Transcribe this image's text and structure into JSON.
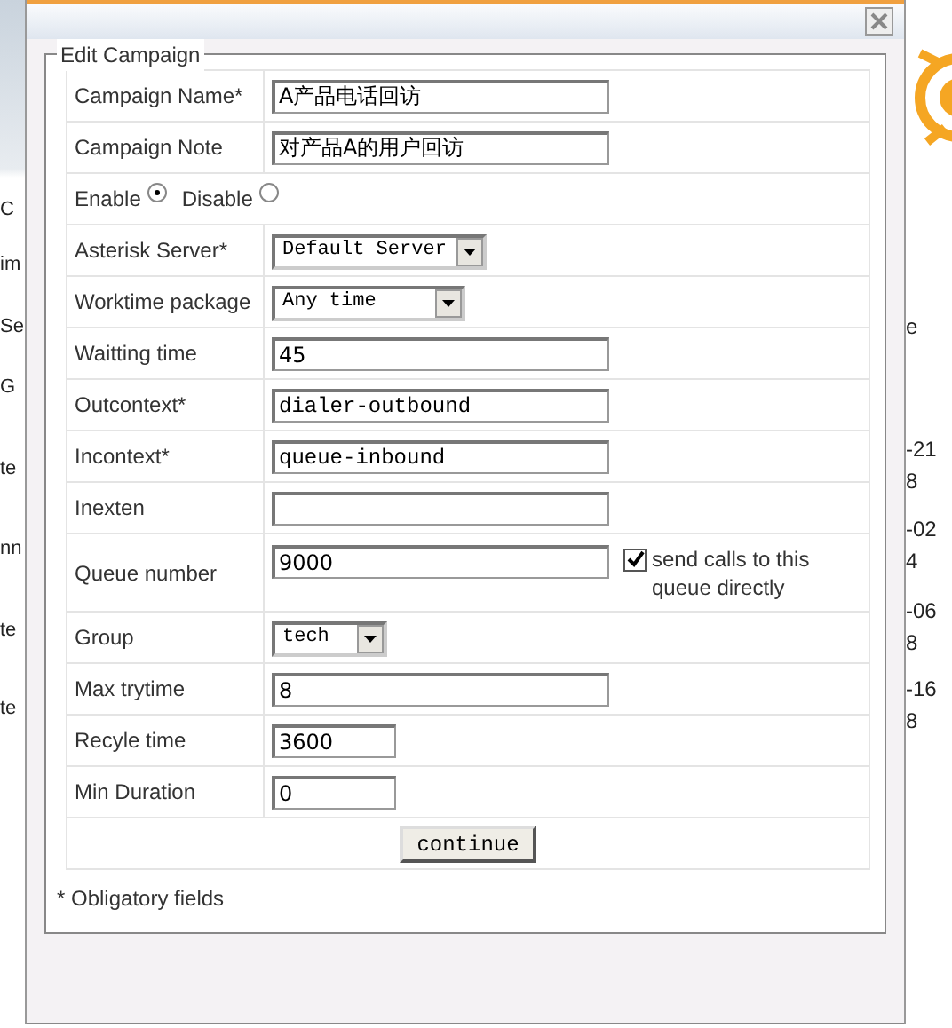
{
  "background_left": [
    {
      "text": "C"
    },
    {
      "text": "im"
    },
    {
      "text": "Se"
    },
    {
      "text": "G"
    },
    {
      "text": "te"
    },
    {
      "text": "nn"
    },
    {
      "text": "te"
    },
    {
      "text": "te"
    }
  ],
  "background_right": [
    {
      "text": "e"
    },
    {
      "text": "-21"
    },
    {
      "text": "8"
    },
    {
      "text": "-02"
    },
    {
      "text": "4"
    },
    {
      "text": "-06"
    },
    {
      "text": "8"
    },
    {
      "text": "-16"
    },
    {
      "text": "8"
    }
  ],
  "dialog": {
    "legend": "Edit Campaign",
    "rows": [
      {
        "kind": "text",
        "label": "Campaign Name*",
        "value": "A产品电话回访"
      },
      {
        "kind": "text",
        "label": "Campaign Note",
        "value": "对产品A的用户回访"
      },
      {
        "kind": "radio",
        "options": [
          {
            "label": "Enable",
            "selected": true
          },
          {
            "label": "Disable",
            "selected": false
          }
        ]
      },
      {
        "kind": "select",
        "label": "Asterisk Server*",
        "value": "Default Server"
      },
      {
        "kind": "select",
        "label": "Worktime package",
        "value": "Any time"
      },
      {
        "kind": "text",
        "label": "Waitting time",
        "value": "45"
      },
      {
        "kind": "mono",
        "label": "Outcontext*",
        "value": "dialer-outbound"
      },
      {
        "kind": "mono",
        "label": "Incontext*",
        "value": "queue-inbound"
      },
      {
        "kind": "text",
        "label": "Inexten"
      },
      {
        "kind": "text",
        "label": "Queue number",
        "value": "9000",
        "checkbox": {
          "label": "send calls to this queue directly",
          "checked": true
        }
      },
      {
        "kind": "select",
        "label": "Group",
        "value": "tech"
      },
      {
        "kind": "text",
        "label": "Max trytime",
        "value": "8"
      },
      {
        "kind": "short",
        "label": "Recyle time",
        "value": "3600"
      },
      {
        "kind": "short",
        "label": "Min Duration",
        "value": "0"
      }
    ],
    "button": "continue",
    "footnote": "* Obligatory fields"
  }
}
